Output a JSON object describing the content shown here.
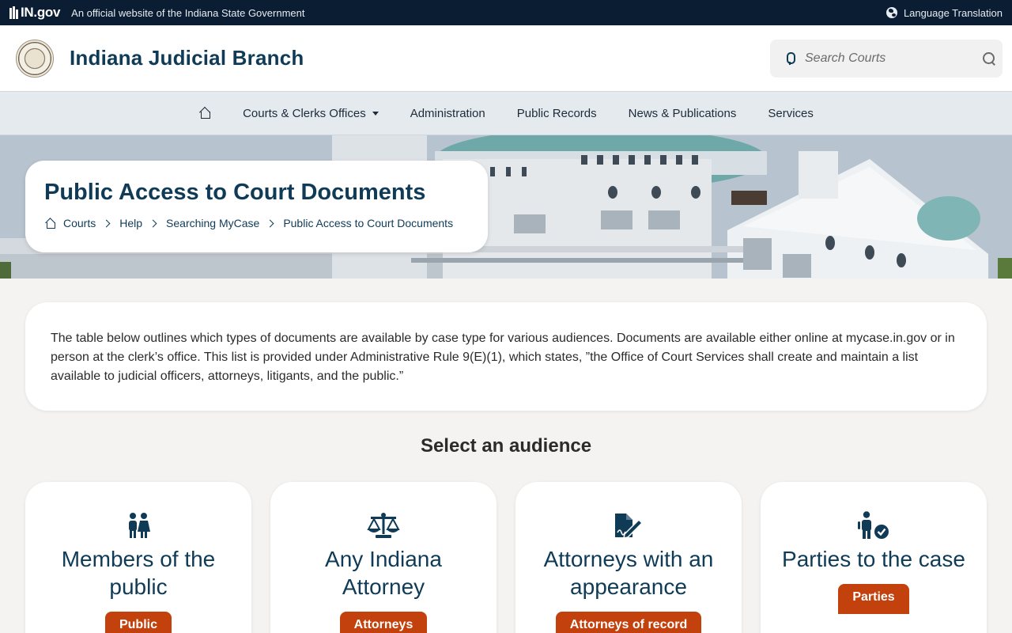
{
  "govbar": {
    "logo_text": "IN.gov",
    "official_text": "An official website of the Indiana State Government",
    "language_label": "Language Translation"
  },
  "header": {
    "title": "Indiana Judicial Branch",
    "search_placeholder": "Search Courts"
  },
  "nav": {
    "items": [
      {
        "label": "Courts & Clerks Offices"
      },
      {
        "label": "Administration"
      },
      {
        "label": "Public Records"
      },
      {
        "label": "News & Publications"
      },
      {
        "label": "Services"
      }
    ]
  },
  "hero": {
    "title": "Public Access to Court Documents",
    "breadcrumbs": [
      "Courts",
      "Help",
      "Searching MyCase",
      "Public Access to Court Documents"
    ]
  },
  "intro": {
    "text": "The table below outlines which types of documents are available by case type for various audiences. Documents are available either online at mycase.in.gov or in person at the clerk’s office. This list is provided under Administrative Rule 9(E)(1), which states, ”the Office of Court Services shall create and maintain a list available to judicial officers, attorneys, litigants, and the public.”"
  },
  "audience": {
    "heading": "Select an audience",
    "cards": [
      {
        "icon": "people-icon",
        "title": "Members of the public",
        "button": "Public"
      },
      {
        "icon": "scales-icon",
        "title": "Any Indiana Attorney",
        "button": "Attorneys"
      },
      {
        "icon": "document-signature-icon",
        "title": "Attorneys with an appearance",
        "button": "Attorneys of record"
      },
      {
        "icon": "person-check-icon",
        "title": "Parties to the case",
        "button": "Parties"
      }
    ]
  },
  "colors": {
    "brand_navy": "#0f3b57",
    "govbar": "#0b1d33",
    "accent_orange": "#c2410c"
  }
}
